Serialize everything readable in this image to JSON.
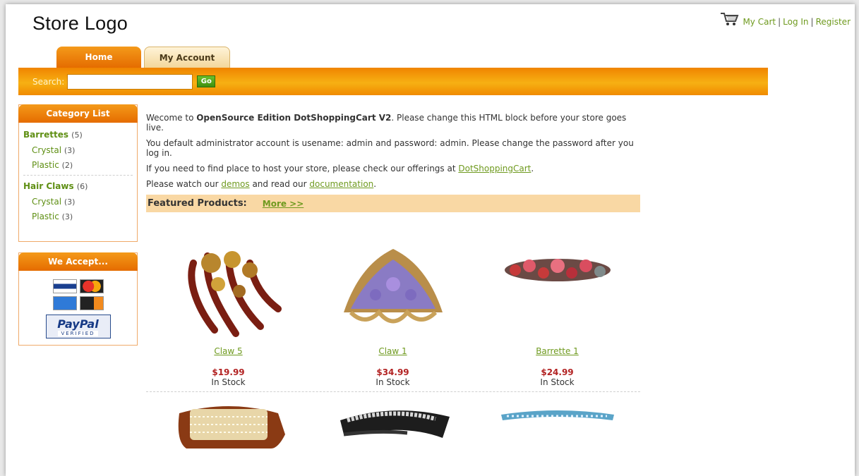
{
  "header": {
    "logo_text": "Store Logo",
    "links": {
      "cart": "My Cart",
      "login": "Log In",
      "register": "Register",
      "separator": "|"
    },
    "icons": {
      "cart": "shopping-cart-icon"
    }
  },
  "tabs": [
    {
      "label": "Home",
      "active": true
    },
    {
      "label": "My Account",
      "active": false
    }
  ],
  "search": {
    "label": "Search:",
    "value": "",
    "placeholder": "",
    "button_label": "Go"
  },
  "sidebar": {
    "category_title": "Category List",
    "categories": [
      {
        "label": "Barrettes",
        "count": "(5)",
        "children": [
          {
            "label": "Crystal",
            "count": "(3)"
          },
          {
            "label": "Plastic",
            "count": "(2)"
          }
        ]
      },
      {
        "label": "Hair Claws",
        "count": "(6)",
        "children": [
          {
            "label": "Crystal",
            "count": "(3)"
          },
          {
            "label": "Plastic",
            "count": "(3)"
          }
        ]
      }
    ],
    "accept_title": "We Accept...",
    "payment_logos": {
      "visa": "VISA",
      "mastercard": "MasterCard",
      "amex": "American Express",
      "discover": "Discover",
      "paypal": "PayPal",
      "paypal_sub": "VERIFIED"
    }
  },
  "welcome": {
    "line1_a": "Wecome to ",
    "line1_bold": "OpenSource Edition DotShoppingCart V2",
    "line1_b": ". Please change this HTML block before your store goes live.",
    "line2": "You default administrator account is usename: admin and password: admin. Please change the password after you log in.",
    "line3_a": "If you need to find place to host your store, please check our offerings at ",
    "line3_link": "DotShoppingCart",
    "line3_b": ".",
    "line4_a": "Please watch our ",
    "line4_link1": "demos",
    "line4_mid": " and read our ",
    "line4_link2": "documentation",
    "line4_b": "."
  },
  "featured": {
    "title": "Featured Products:",
    "more_link": "More >>"
  },
  "products": [
    {
      "name": "Claw 5",
      "price": "$19.99",
      "stock": "In Stock"
    },
    {
      "name": "Claw 1",
      "price": "$34.99",
      "stock": "In Stock"
    },
    {
      "name": "Barrette 1",
      "price": "$24.99",
      "stock": "In Stock"
    }
  ],
  "colors": {
    "orange": "#f08400",
    "link_green": "#6f9a1f",
    "price_red": "#b22222",
    "featured_bg": "#f9d8a4"
  }
}
